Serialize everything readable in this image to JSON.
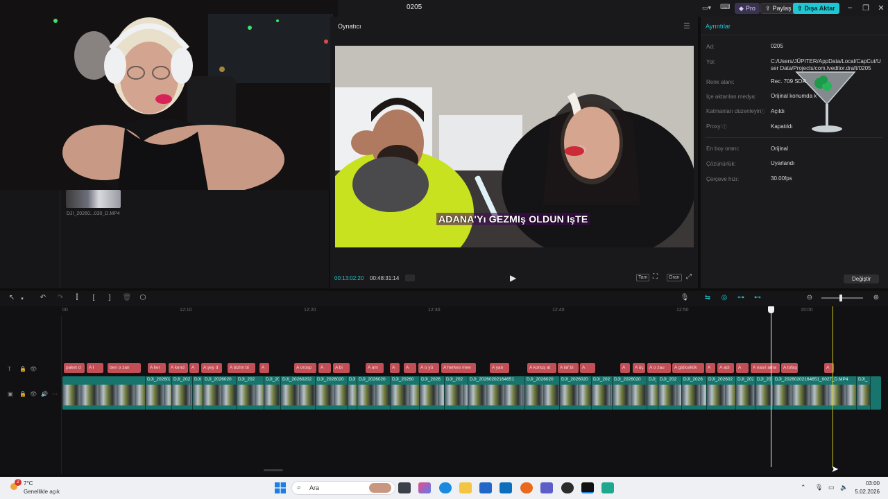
{
  "window": {
    "project_title": "0205",
    "pro": "Pro",
    "share": "Paylaş",
    "export": "Dışa Aktar"
  },
  "media": {
    "thumb_label": "DJI_20260...030_D.MP4"
  },
  "player": {
    "title": "Oynatıcı",
    "subtitle": "ADANA'Yı GEZMIş OLDUN IşTE",
    "time_current": "00:13:02:20",
    "time_total": "00:48:31:14",
    "ctrl_full": "Tam",
    "ctrl_ratio": "Oran"
  },
  "details": {
    "title": "Ayrıntılar",
    "rows": [
      {
        "label": "Ad:",
        "value": "0205"
      },
      {
        "label": "Yol:",
        "value": "C:/Users/JÜPITER/AppData/Local/CapCut/User Data/Projects/com.lveditor.draft/0205"
      },
      {
        "label": "Renk alanı:",
        "value": "Rec. 709 SDR"
      },
      {
        "label": "İçe aktarılan medya:",
        "value": "Orijinal konumda k"
      },
      {
        "label": "Katmanları düzenleyin",
        "value": "Açıldı"
      },
      {
        "label": "Proxy:",
        "value": "Kapatıldı"
      },
      {
        "label": "En boy oranı:",
        "value": "Orijinal"
      },
      {
        "label": "Çözünürlük:",
        "value": "Uyarlandı"
      },
      {
        "label": "Çerçeve hızı:",
        "value": "30.00fps"
      }
    ],
    "change_button": "Değiştir"
  },
  "ruler": [
    "00",
    "12:10",
    "12:20",
    "12:30",
    "12:40",
    "12:50",
    "15:00"
  ],
  "text_clips": [
    "paket d",
    "A ł",
    "ben o zan",
    "A ker",
    "A kend",
    "A ",
    "A şey d",
    "A bizim bi",
    "A ",
    "A orosp",
    "A ",
    "A bi",
    "A am",
    "A ",
    "A ",
    "A o yü",
    "A herkes mee",
    "A yan",
    "A konuş at",
    "A laf bi",
    "A ",
    "A ",
    "A üç",
    "A o zau",
    "A gidicektik",
    "A ",
    "A adı",
    "A ",
    "A nasıl ama",
    "A tofaş",
    "A "
  ],
  "video_clips": [
    "DJI_20260202",
    "DJI_202",
    "DJI_",
    "DJI_2026020",
    "DJI_202",
    "DJI_20",
    "DJI_20260202",
    "DJI_2026020",
    "DJI_",
    "DJI_2026020",
    "DJI_20260",
    "DJI_2026",
    "DJI_202",
    "DJI_20260202164651",
    "DJI_2026020",
    "DJI_2026020",
    "DJI_202",
    "DJI_2026020",
    "DJI_",
    "DJI_202",
    "DJI_2026",
    "DJI_202602",
    "DJI_202",
    "DJI_202",
    "DJI_20260202164651_0027_D.MP4",
    "DJI_"
  ],
  "taskbar": {
    "temperature": "7°C",
    "weather": "Genellikle açık",
    "badge": "2",
    "search": "Ara",
    "time": "03:00",
    "date": "5.02.2026"
  },
  "colors": {
    "accent": "#1ec7d2",
    "text_clip": "#c24e56",
    "video_clip": "#17756d",
    "playhead": "#f1f1f1",
    "cursor_line": "#c7c31e"
  }
}
